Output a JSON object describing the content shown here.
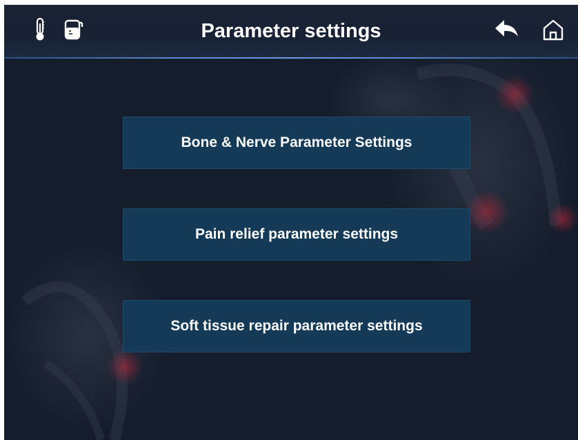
{
  "header": {
    "title": "Parameter settings",
    "left_icons": [
      "thermometer-icon",
      "water-tank-icon"
    ],
    "right_icons": [
      "back-arrow-icon",
      "home-icon"
    ]
  },
  "menu": {
    "items": [
      {
        "label": "Bone & Nerve Parameter Settings"
      },
      {
        "label": "Pain relief parameter settings"
      },
      {
        "label": "Soft tissue repair parameter settings"
      }
    ]
  },
  "colors": {
    "background": "#151d2c",
    "button": "#143a58",
    "header_line": "#5a8ad0",
    "text": "#ffffff"
  }
}
